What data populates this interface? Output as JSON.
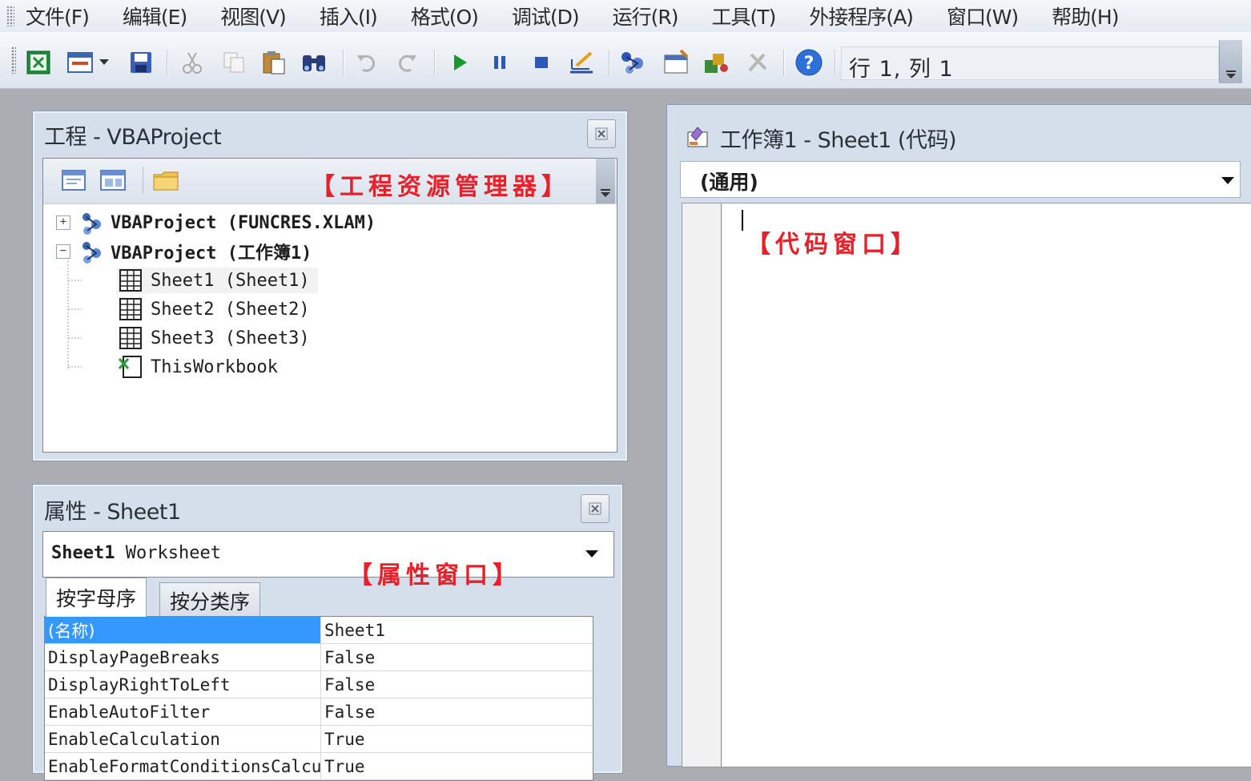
{
  "menu": [
    "文件(F)",
    "编辑(E)",
    "视图(V)",
    "插入(I)",
    "格式(O)",
    "调试(D)",
    "运行(R)",
    "工具(T)",
    "外接程序(A)",
    "窗口(W)",
    "帮助(H)"
  ],
  "toolbar": {
    "position_label": "行 1, 列 1",
    "icons": [
      "excel-icon",
      "insert-userform-icon",
      "dropdown-arrow-icon",
      "save-icon",
      "cut-icon",
      "copy-icon",
      "paste-icon",
      "find-icon",
      "undo-icon",
      "redo-icon",
      "run-icon",
      "break-icon",
      "reset-icon",
      "design-mode-icon",
      "project-explorer-icon",
      "properties-window-icon",
      "object-browser-icon",
      "toolbox-icon",
      "help-icon"
    ]
  },
  "project_explorer": {
    "title": "工程 - VBAProject",
    "annotation": "【工程资源管理器】",
    "tree": [
      {
        "label": "VBAProject (FUNCRES.XLAM)",
        "expander": "+"
      },
      {
        "label": "VBAProject (工作簿1)",
        "expander": "−"
      },
      {
        "label": "Sheet1 (Sheet1)"
      },
      {
        "label": "Sheet2 (Sheet2)"
      },
      {
        "label": "Sheet3 (Sheet3)"
      },
      {
        "label": "ThisWorkbook"
      }
    ]
  },
  "properties": {
    "title": "属性 - Sheet1",
    "annotation": "【属性窗口】",
    "object_name": "Sheet1",
    "object_type": "Worksheet",
    "tabs": [
      "按字母序",
      "按分类序"
    ],
    "rows": [
      {
        "key": "(名称)",
        "value": "Sheet1"
      },
      {
        "key": "DisplayPageBreaks",
        "value": "False"
      },
      {
        "key": "DisplayRightToLeft",
        "value": "False"
      },
      {
        "key": "EnableAutoFilter",
        "value": "False"
      },
      {
        "key": "EnableCalculation",
        "value": "True"
      },
      {
        "key": "EnableFormatConditionsCalculation",
        "value": "True"
      }
    ]
  },
  "code_window": {
    "title": "工作簿1 - Sheet1 (代码)",
    "object_combo": "(通用)",
    "annotation": "【代码窗口】"
  },
  "colors": {
    "annotation_red": "#e8202a",
    "selection_blue": "#3399ff",
    "title_blue": "#d5dfec"
  }
}
